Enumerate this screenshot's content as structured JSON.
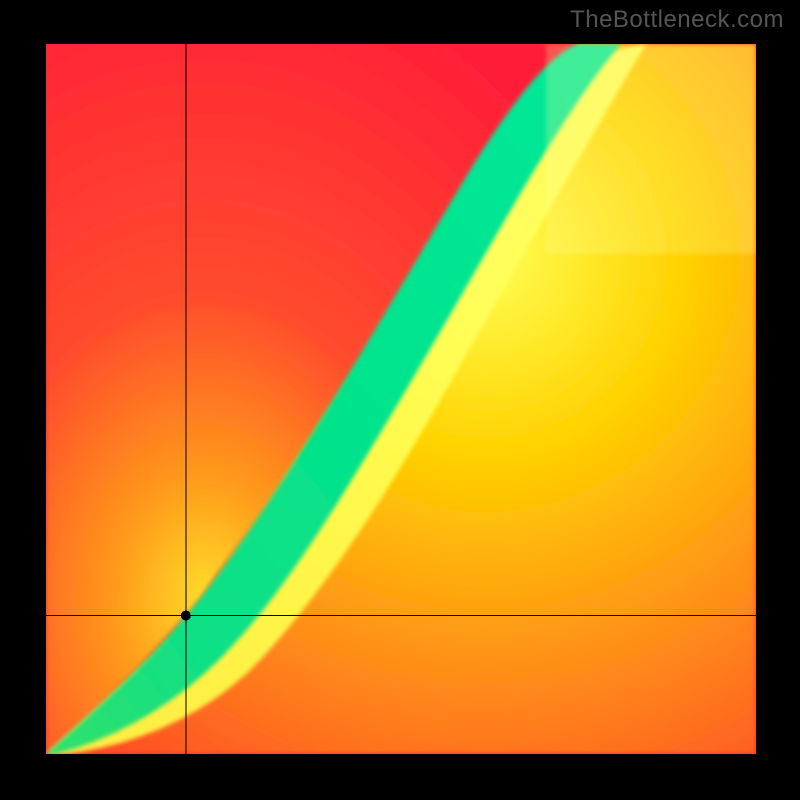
{
  "attribution": "TheBottleneck.com",
  "colors": {
    "hot": "#ff1f3a",
    "warm": "#ff7a1a",
    "mid": "#ffd400",
    "bright": "#ffff33",
    "good": "#00e38a",
    "corner": "#ffffa8"
  },
  "crosshair": {
    "x_frac": 0.197,
    "y_frac": 0.805,
    "dot_r": 5
  },
  "chart_data": {
    "type": "heatmap",
    "title": "",
    "xlabel": "",
    "ylabel": "",
    "xlim": [
      0,
      1
    ],
    "ylim": [
      0,
      1
    ],
    "description": "Optimal-match ridge heatmap. Green band marks well-balanced pairings; red regions indicate severe bottleneck. Crosshair shows selected configuration slightly below the green ridge near the low end.",
    "ridge_points": [
      {
        "x": 0.0,
        "y": 0.0
      },
      {
        "x": 0.05,
        "y": 0.05
      },
      {
        "x": 0.1,
        "y": 0.11
      },
      {
        "x": 0.15,
        "y": 0.15
      },
      {
        "x": 0.2,
        "y": 0.18
      },
      {
        "x": 0.25,
        "y": 0.21
      },
      {
        "x": 0.3,
        "y": 0.3
      },
      {
        "x": 0.35,
        "y": 0.4
      },
      {
        "x": 0.4,
        "y": 0.49
      },
      {
        "x": 0.45,
        "y": 0.57
      },
      {
        "x": 0.5,
        "y": 0.64
      },
      {
        "x": 0.55,
        "y": 0.72
      },
      {
        "x": 0.6,
        "y": 0.79
      },
      {
        "x": 0.65,
        "y": 0.86
      },
      {
        "x": 0.7,
        "y": 0.93
      },
      {
        "x": 0.75,
        "y": 1.0
      }
    ],
    "ridge_halfwidth_start": 0.02,
    "ridge_halfwidth_end": 0.06,
    "crosshair_point": {
      "x": 0.197,
      "y": 0.195
    }
  }
}
